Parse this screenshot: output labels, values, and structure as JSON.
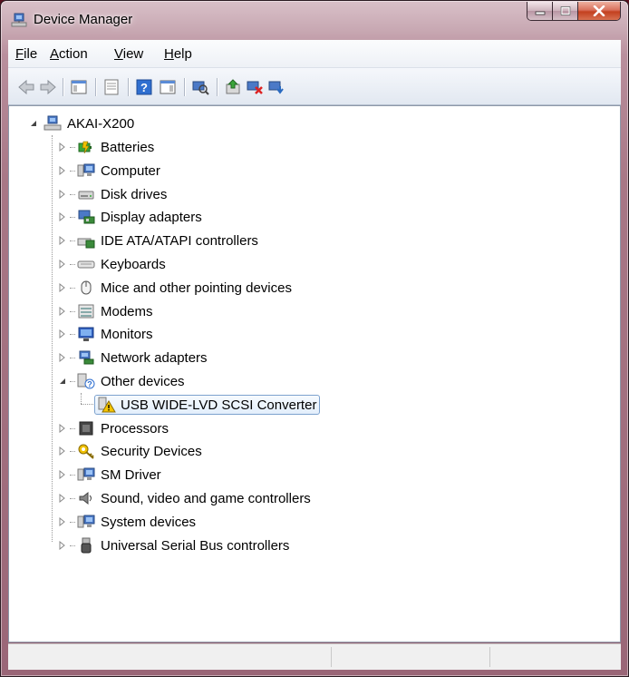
{
  "window": {
    "title": "Device Manager",
    "accent": "#b98f9d"
  },
  "menu": {
    "items": [
      {
        "label": "File"
      },
      {
        "label": "Action"
      },
      {
        "label": "View"
      },
      {
        "label": "Help"
      }
    ]
  },
  "toolbar": {
    "buttons": [
      "back-icon",
      "forward-icon",
      "show-hide-console-tree-icon",
      "properties-icon",
      "help-icon",
      "show-action-pane-icon",
      "scan-hardware-icon",
      "update-driver-icon",
      "disable-device-icon",
      "uninstall-device-icon"
    ]
  },
  "tree": {
    "root": {
      "label": "AKAI-X200",
      "icon": "computer-network-icon",
      "expanded": true
    },
    "categories": [
      {
        "label": "Batteries",
        "icon": "battery-icon"
      },
      {
        "label": "Computer",
        "icon": "computer-icon"
      },
      {
        "label": "Disk drives",
        "icon": "disk-drive-icon"
      },
      {
        "label": "Display adapters",
        "icon": "display-adapter-icon"
      },
      {
        "label": "IDE ATA/ATAPI controllers",
        "icon": "ide-controller-icon"
      },
      {
        "label": "Keyboards",
        "icon": "keyboard-icon"
      },
      {
        "label": "Mice and other pointing devices",
        "icon": "mouse-icon"
      },
      {
        "label": "Modems",
        "icon": "modem-icon"
      },
      {
        "label": "Monitors",
        "icon": "monitor-icon"
      },
      {
        "label": "Network adapters",
        "icon": "network-adapter-icon"
      },
      {
        "label": "Other devices",
        "icon": "unknown-device-icon",
        "expanded": true
      },
      {
        "label": "Processors",
        "icon": "processor-icon"
      },
      {
        "label": "Security Devices",
        "icon": "security-key-icon"
      },
      {
        "label": "SM Driver",
        "icon": "computer-icon"
      },
      {
        "label": "Sound, video and game controllers",
        "icon": "speaker-icon"
      },
      {
        "label": "System devices",
        "icon": "computer-icon"
      },
      {
        "label": "Universal Serial Bus controllers",
        "icon": "usb-icon"
      }
    ],
    "other_devices_children": [
      {
        "label": "USB WIDE-LVD SCSI Converter",
        "icon": "warning-device-icon",
        "selected": true
      }
    ]
  },
  "statusbar": {
    "cells": [
      "",
      "",
      ""
    ]
  }
}
